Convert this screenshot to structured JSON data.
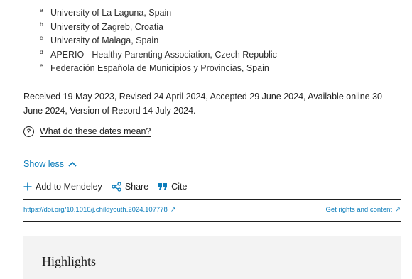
{
  "affiliations": [
    {
      "sup": "a",
      "text": "University of La Laguna, Spain"
    },
    {
      "sup": "b",
      "text": "University of Zagreb, Croatia"
    },
    {
      "sup": "c",
      "text": "University of Malaga, Spain"
    },
    {
      "sup": "d",
      "text": "APERIO - Healthy Parenting Association, Czech Republic"
    },
    {
      "sup": "e",
      "text": "Federación Española de Municipios y Provincias, Spain"
    }
  ],
  "dates_text": "Received 19 May 2023, Revised 24 April 2024, Accepted 29 June 2024, Available online 30 June 2024, Version of Record 14 July 2024.",
  "dates_help": {
    "icon": "question-circle-icon",
    "q": "?",
    "label": "What do these dates mean?"
  },
  "show_less": {
    "label": "Show less",
    "icon": "chevron-up-icon"
  },
  "actions": {
    "mendeley": {
      "label": "Add to Mendeley",
      "icon": "plus-icon"
    },
    "share": {
      "label": "Share",
      "icon": "share-icon"
    },
    "cite": {
      "label": "Cite",
      "icon": "quote-icon"
    }
  },
  "doi_link": "https://doi.org/10.1016/j.childyouth.2024.107778",
  "rights_link": "Get rights and content",
  "external_arrow": "↗",
  "highlights_title": "Highlights",
  "colors": {
    "link": "#0c7dbb",
    "text": "#1f1f1f",
    "panel": "#f3f3f3"
  }
}
